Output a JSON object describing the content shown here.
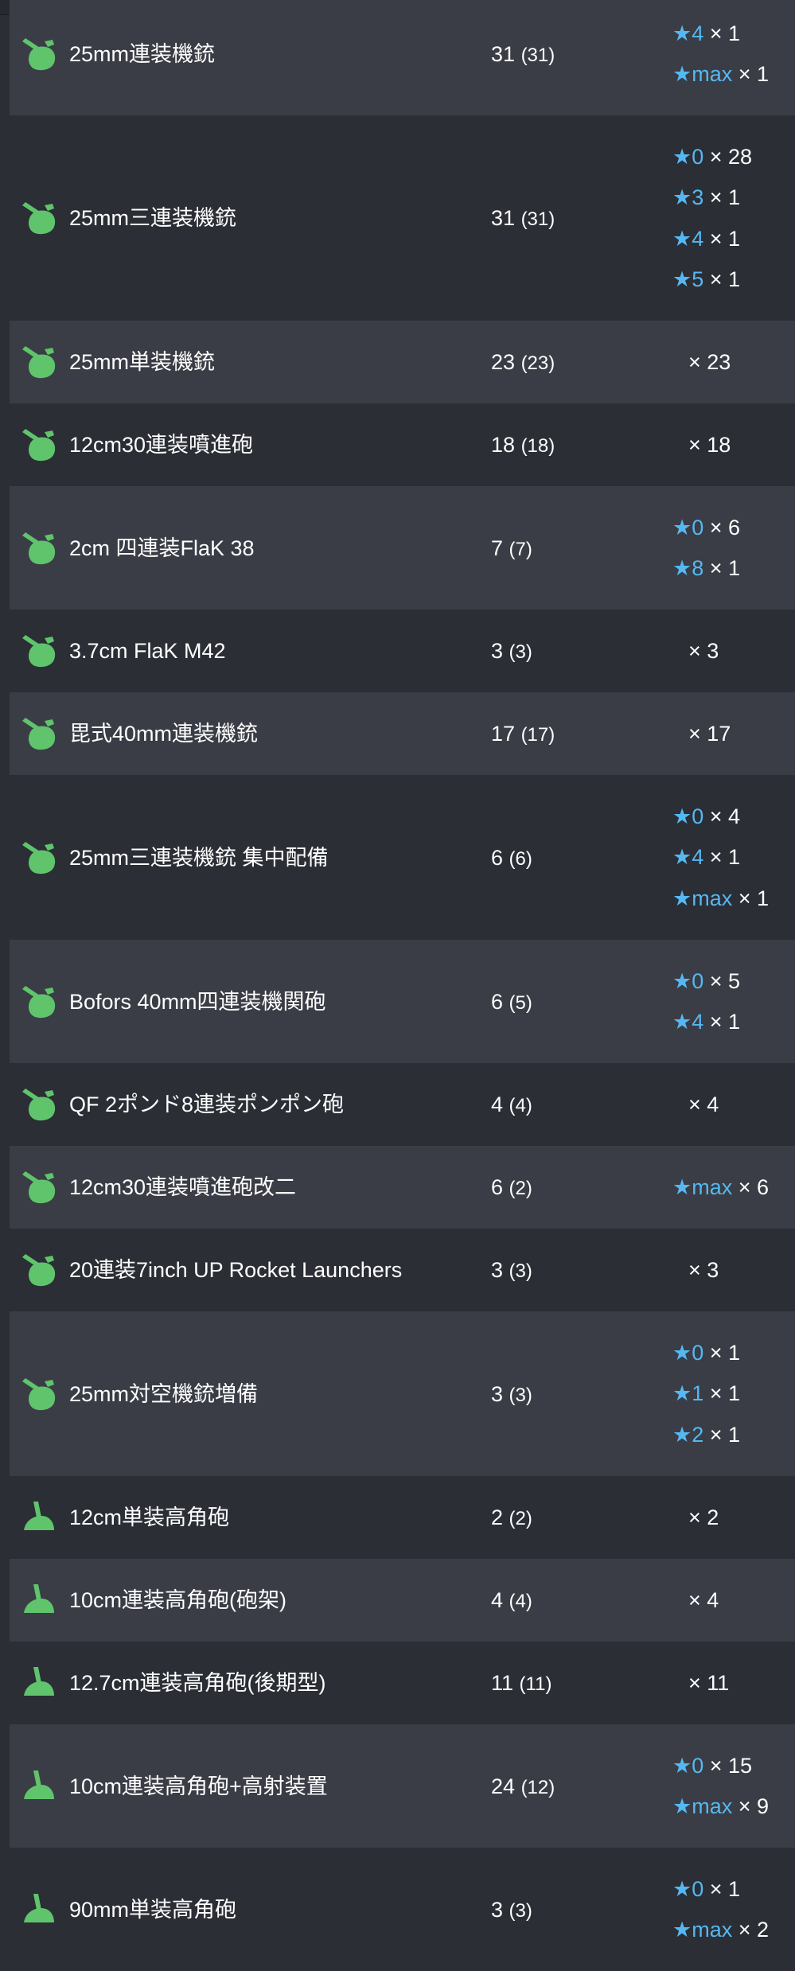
{
  "colors": {
    "background": "#2b2e35",
    "row_alt": "#3a3d45",
    "star": "#55b8f2",
    "icon_green": "#5fc46c"
  },
  "rows": [
    {
      "name": "25mm連装機銃",
      "icon": "aa-gun-icon",
      "count": "31",
      "paren": "(31)",
      "imps": [
        {
          "star": "★4",
          "mult": "× 1"
        },
        {
          "star": "★max",
          "mult": "× 1"
        }
      ]
    },
    {
      "name": "25mm三連装機銃",
      "icon": "aa-gun-icon",
      "count": "31",
      "paren": "(31)",
      "imps": [
        {
          "star": "★0",
          "mult": "× 28"
        },
        {
          "star": "★3",
          "mult": "× 1"
        },
        {
          "star": "★4",
          "mult": "× 1"
        },
        {
          "star": "★5",
          "mult": "× 1"
        }
      ]
    },
    {
      "name": "25mm単装機銃",
      "icon": "aa-gun-icon",
      "count": "23",
      "paren": "(23)",
      "imps": [
        {
          "star": "",
          "mult": "× 23"
        }
      ]
    },
    {
      "name": "12cm30連装噴進砲",
      "icon": "aa-gun-icon",
      "count": "18",
      "paren": "(18)",
      "imps": [
        {
          "star": "",
          "mult": "× 18"
        }
      ]
    },
    {
      "name": "2cm 四連装FlaK 38",
      "icon": "aa-gun-icon",
      "count": "7",
      "paren": "(7)",
      "imps": [
        {
          "star": "★0",
          "mult": "× 6"
        },
        {
          "star": "★8",
          "mult": "× 1"
        }
      ]
    },
    {
      "name": "3.7cm FlaK M42",
      "icon": "aa-gun-icon",
      "count": "3",
      "paren": "(3)",
      "imps": [
        {
          "star": "",
          "mult": "× 3"
        }
      ]
    },
    {
      "name": "毘式40mm連装機銃",
      "icon": "aa-gun-icon",
      "count": "17",
      "paren": "(17)",
      "imps": [
        {
          "star": "",
          "mult": "× 17"
        }
      ]
    },
    {
      "name": "25mm三連装機銃 集中配備",
      "icon": "aa-gun-icon",
      "count": "6",
      "paren": "(6)",
      "imps": [
        {
          "star": "★0",
          "mult": "× 4"
        },
        {
          "star": "★4",
          "mult": "× 1"
        },
        {
          "star": "★max",
          "mult": "× 1"
        }
      ]
    },
    {
      "name": "Bofors 40mm四連装機関砲",
      "icon": "aa-gun-icon",
      "count": "6",
      "paren": "(5)",
      "imps": [
        {
          "star": "★0",
          "mult": "× 5"
        },
        {
          "star": "★4",
          "mult": "× 1"
        }
      ]
    },
    {
      "name": "QF 2ポンド8連装ポンポン砲",
      "icon": "aa-gun-icon",
      "count": "4",
      "paren": "(4)",
      "imps": [
        {
          "star": "",
          "mult": "× 4"
        }
      ]
    },
    {
      "name": "12cm30連装噴進砲改二",
      "icon": "aa-gun-icon",
      "count": "6",
      "paren": "(2)",
      "imps": [
        {
          "star": "★max",
          "mult": "× 6"
        }
      ]
    },
    {
      "name": "20連装7inch UP Rocket Launchers",
      "icon": "aa-gun-icon",
      "count": "3",
      "paren": "(3)",
      "imps": [
        {
          "star": "",
          "mult": "× 3"
        }
      ]
    },
    {
      "name": "25mm対空機銃増備",
      "icon": "aa-gun-icon",
      "count": "3",
      "paren": "(3)",
      "imps": [
        {
          "star": "★0",
          "mult": "× 1"
        },
        {
          "star": "★1",
          "mult": "× 1"
        },
        {
          "star": "★2",
          "mult": "× 1"
        }
      ]
    },
    {
      "name": "12cm単装高角砲",
      "icon": "ha-gun-icon",
      "count": "2",
      "paren": "(2)",
      "imps": [
        {
          "star": "",
          "mult": "× 2"
        }
      ]
    },
    {
      "name": "10cm連装高角砲(砲架)",
      "icon": "ha-gun-icon",
      "count": "4",
      "paren": "(4)",
      "imps": [
        {
          "star": "",
          "mult": "× 4"
        }
      ]
    },
    {
      "name": "12.7cm連装高角砲(後期型)",
      "icon": "ha-gun-icon",
      "count": "11",
      "paren": "(11)",
      "imps": [
        {
          "star": "",
          "mult": "× 11"
        }
      ]
    },
    {
      "name": "10cm連装高角砲+高射装置",
      "icon": "ha-gun-icon",
      "count": "24",
      "paren": "(12)",
      "imps": [
        {
          "star": "★0",
          "mult": "× 15"
        },
        {
          "star": "★max",
          "mult": "× 9"
        }
      ]
    },
    {
      "name": "90mm単装高角砲",
      "icon": "ha-gun-icon",
      "count": "3",
      "paren": "(3)",
      "imps": [
        {
          "star": "★0",
          "mult": "× 1"
        },
        {
          "star": "★max",
          "mult": "× 2"
        }
      ]
    }
  ]
}
